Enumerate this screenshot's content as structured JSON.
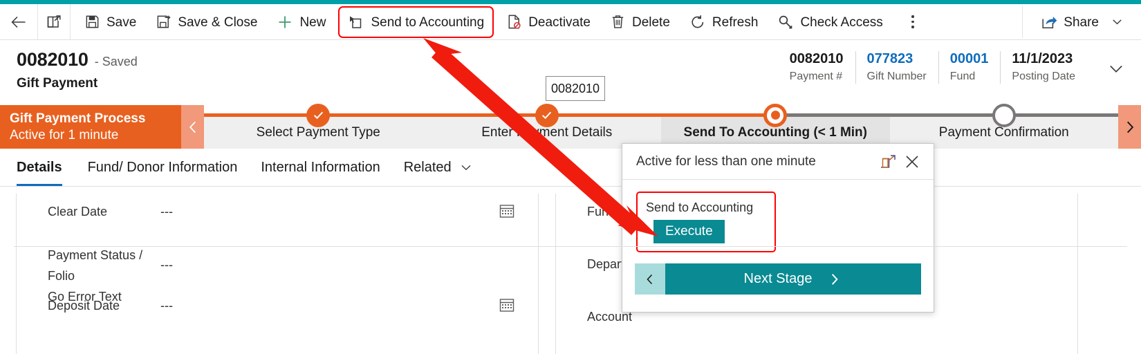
{
  "theme": {
    "teal_accent": "#00a0a8",
    "bpf_orange": "#e8601f",
    "link_blue": "#0f6cbd",
    "annotation_red": "#ff0000",
    "action_teal": "#0a8a92"
  },
  "command_bar": {
    "back": "",
    "popout": "",
    "items": [
      {
        "id": "save",
        "label": "Save",
        "icon": "save-icon"
      },
      {
        "id": "save-close",
        "label": "Save & Close",
        "icon": "save-close-icon"
      },
      {
        "id": "new",
        "label": "New",
        "icon": "plus-icon"
      },
      {
        "id": "send-to-accounting",
        "label": "Send to Accounting",
        "icon": "send-to-accounting-icon",
        "highlighted": true
      },
      {
        "id": "deactivate",
        "label": "Deactivate",
        "icon": "deactivate-icon"
      },
      {
        "id": "delete",
        "label": "Delete",
        "icon": "trash-icon"
      },
      {
        "id": "refresh",
        "label": "Refresh",
        "icon": "refresh-icon"
      },
      {
        "id": "check-access",
        "label": "Check Access",
        "icon": "key-icon"
      }
    ],
    "overflow": "more-commands",
    "share": {
      "label": "Share",
      "icon": "share-icon"
    }
  },
  "record_header": {
    "record_number": "0082010",
    "state": "- Saved",
    "entity": "Gift Payment",
    "fields": [
      {
        "value": "0082010",
        "label": "Payment #",
        "link": false
      },
      {
        "value": "077823",
        "label": "Gift Number",
        "link": true
      },
      {
        "value": "00001",
        "label": "Fund",
        "link": true
      },
      {
        "value": "11/1/2023",
        "label": "Posting Date",
        "link": false
      }
    ]
  },
  "tooltip_box": {
    "text": "0082010"
  },
  "process_flow": {
    "name": "Gift Payment Process",
    "active_for": "Active for 1 minute",
    "stages": [
      {
        "label": "Select Payment Type",
        "state": "complete"
      },
      {
        "label": "Enter Payment Details",
        "state": "complete"
      },
      {
        "label": "Send To Accounting  (< 1 Min)",
        "state": "current"
      },
      {
        "label": "Payment Confirmation",
        "state": "future"
      }
    ]
  },
  "tabs": [
    {
      "label": "Details",
      "selected": true
    },
    {
      "label": "Fund/ Donor Information",
      "selected": false
    },
    {
      "label": "Internal Information",
      "selected": false
    },
    {
      "label": "Related",
      "selected": false,
      "caret": true
    }
  ],
  "form": {
    "left_column": [
      {
        "label": "Clear Date",
        "value": "---",
        "icon": "calendar-icon"
      },
      {
        "label": "Payment Status / Folio\nGo Error Text",
        "value": "---",
        "icon": ""
      },
      {
        "label": "Deposit Date",
        "value": "---",
        "icon": "calendar-icon"
      }
    ],
    "right_column": [
      {
        "label": "Fund",
        "value": ""
      },
      {
        "label": "Department",
        "value": ""
      },
      {
        "label": "Account",
        "value": ""
      }
    ]
  },
  "flyout": {
    "title": "Active for less than one minute",
    "expand_icon": "popout-icon",
    "close_icon": "close-icon",
    "action": {
      "label": "Send to Accounting",
      "button": "Execute",
      "highlighted": true
    },
    "next_stage": {
      "back_icon": "chevron-left-icon",
      "label": "Next Stage",
      "forward_icon": "chevron-right-icon"
    }
  },
  "annotation": {
    "type": "double-headed-arrow",
    "from": "send-to-accounting-toolbar-button",
    "to": "send-to-accounting-execute-action"
  }
}
